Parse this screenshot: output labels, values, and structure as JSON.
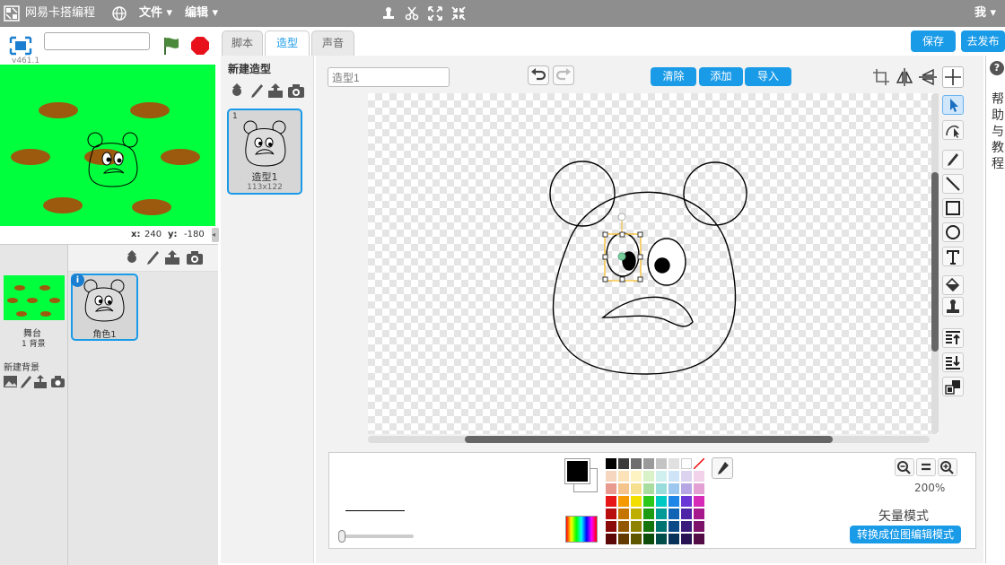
{
  "topbar": {
    "app_name": "网易卡搭编程",
    "menu_file": "文件",
    "menu_edit": "编辑",
    "user": "我"
  },
  "stage": {
    "version": "v461.1",
    "title_value": "",
    "coord_x_label": "x:",
    "coord_x": "240",
    "coord_y_label": "y:",
    "coord_y": "-180",
    "bg_color": "#00ff3c"
  },
  "sprites": {
    "stage_label": "舞台",
    "stage_backdrops": "1 背景",
    "new_backdrop": "新建背景",
    "sprite1_name": "角色1"
  },
  "tabs": {
    "scripts": "脚本",
    "costumes": "造型",
    "sounds": "声音"
  },
  "header_buttons": {
    "save": "保存",
    "publish": "去发布"
  },
  "costumes": {
    "new_costume": "新建造型",
    "item1_index": "1",
    "item1_name": "造型1",
    "item1_size": "113x122"
  },
  "editor": {
    "costume_name": "造型1",
    "clear": "清除",
    "add": "添加",
    "import": "导入",
    "zoom": "200%",
    "mode": "矢量模式",
    "convert": "转换成位图编辑模式"
  },
  "help": {
    "label": "帮助与教程"
  },
  "colors": {
    "accent": "#1a9be8",
    "stage_green": "#00ff3c",
    "topbar": "#8e8e8e"
  }
}
